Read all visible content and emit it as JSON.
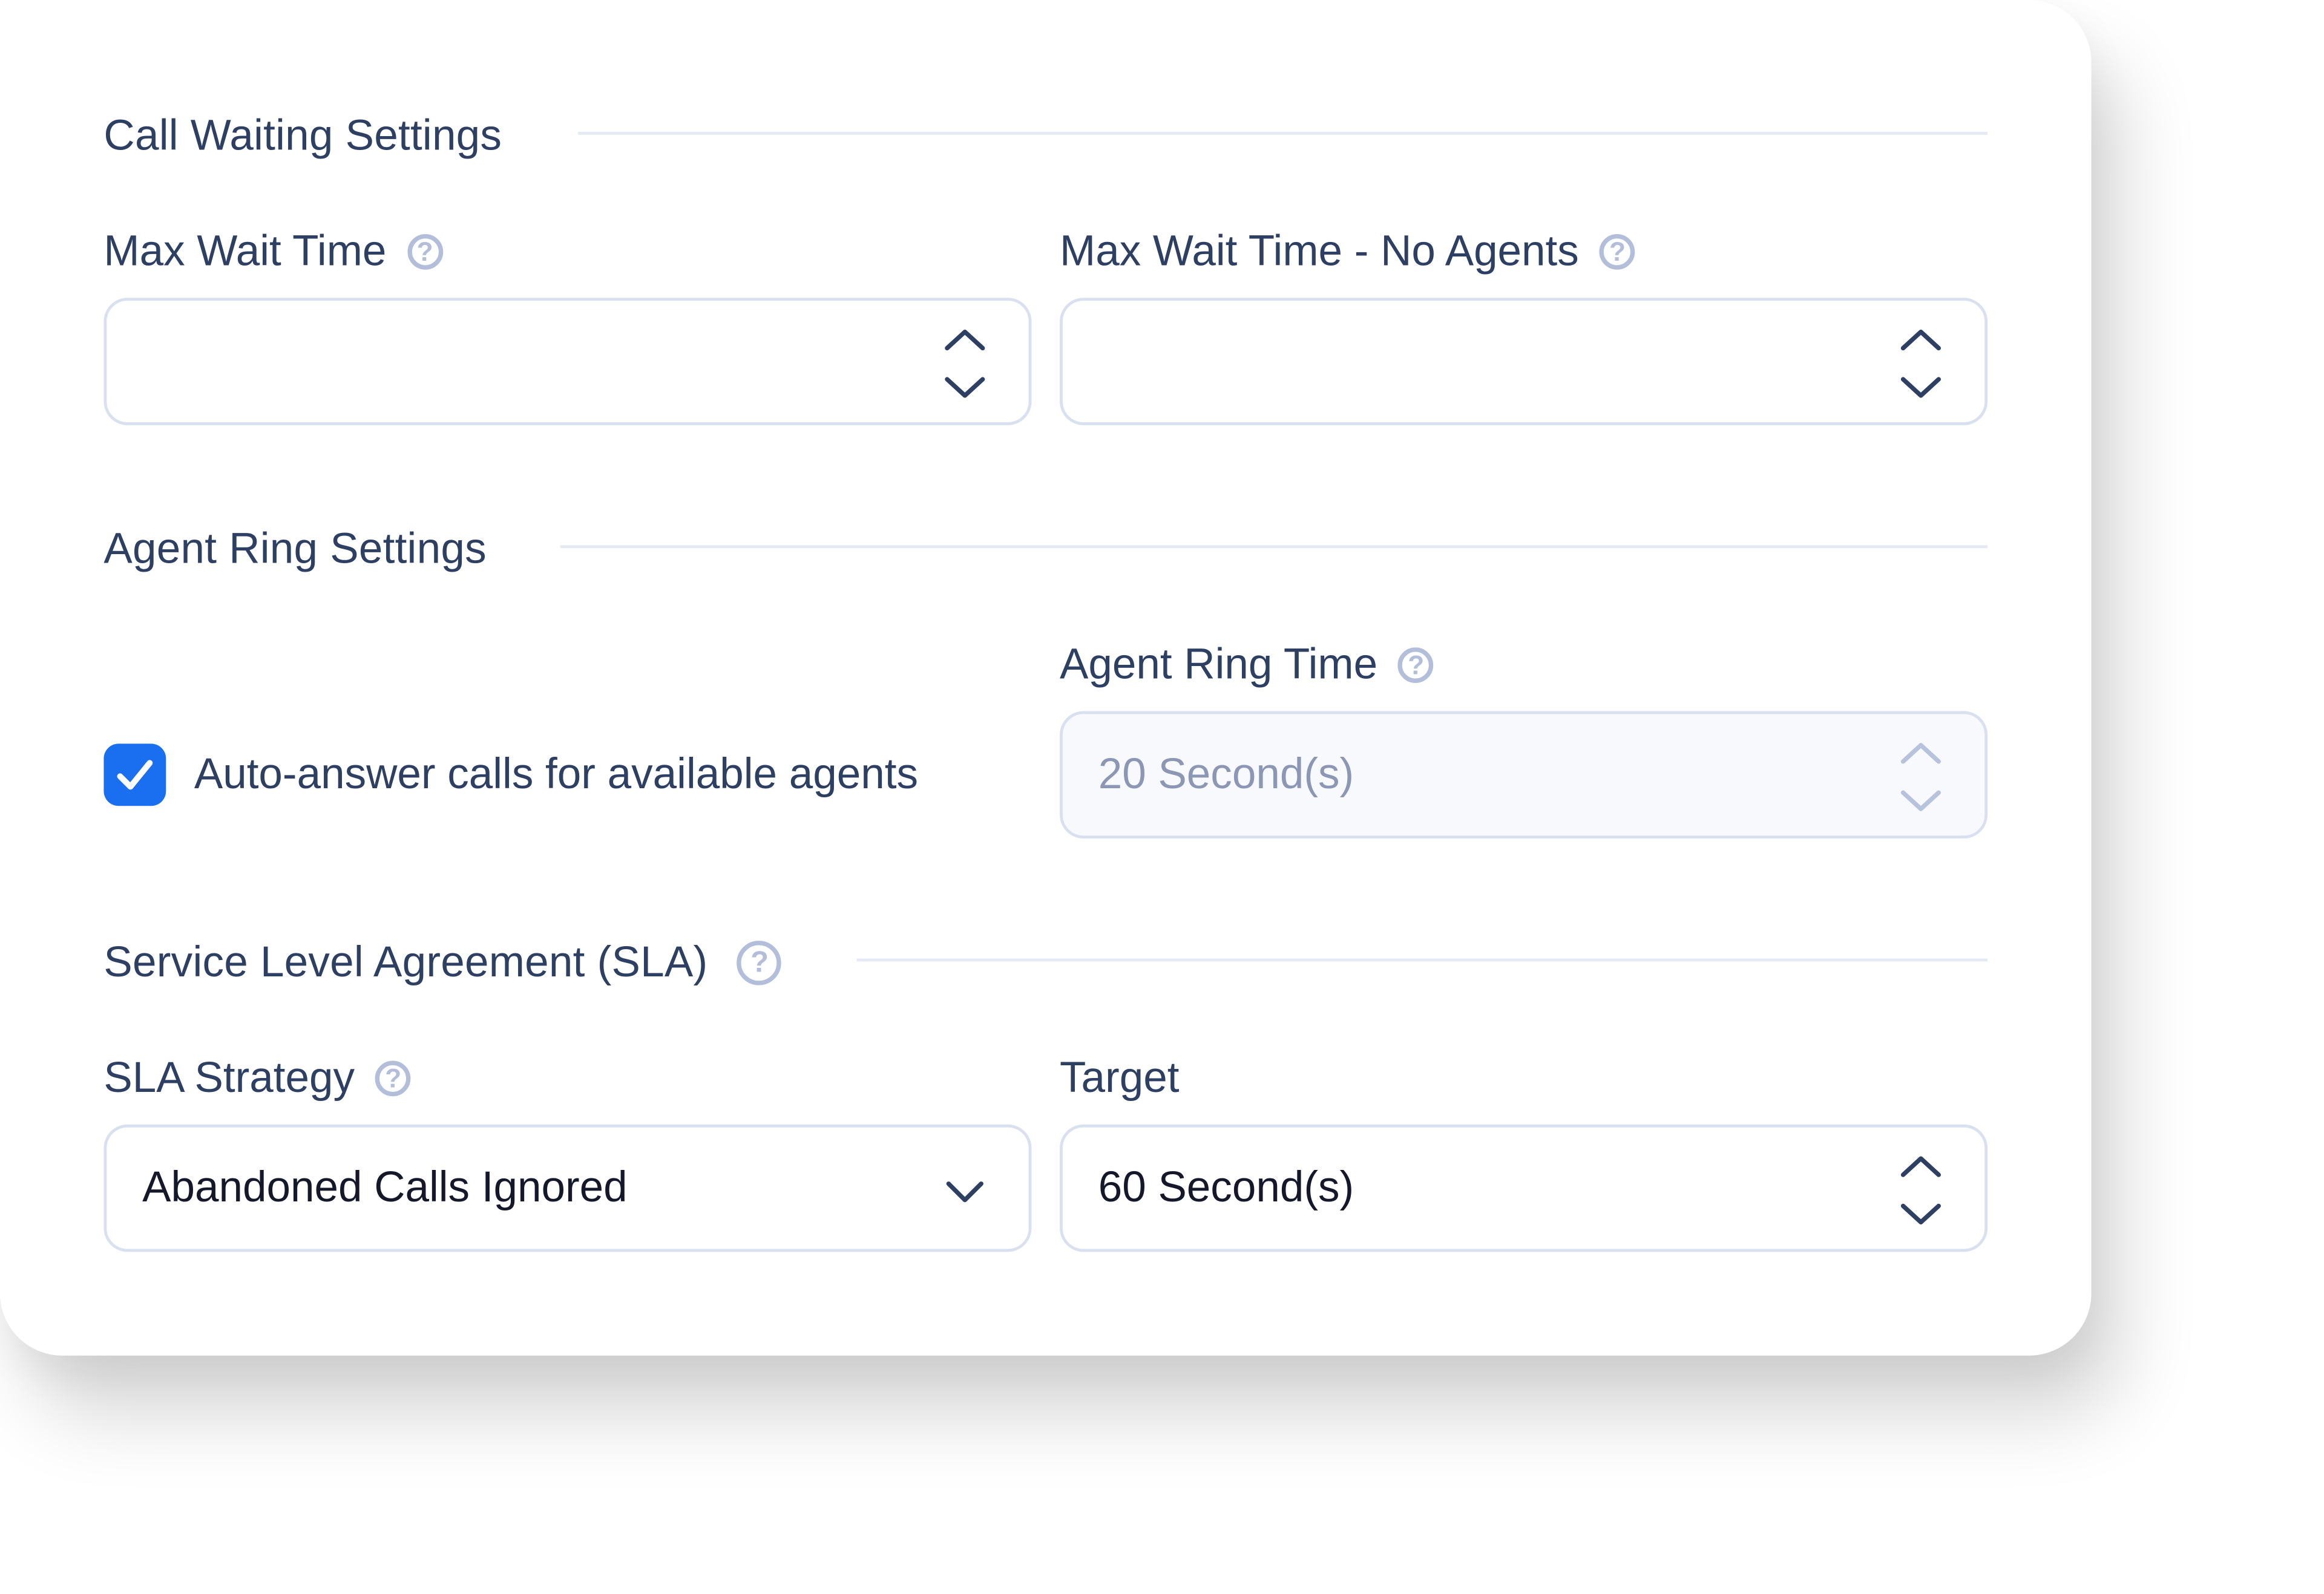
{
  "sections": {
    "call_waiting": {
      "title": "Call Waiting Settings",
      "max_wait_time": {
        "label": "Max Wait Time",
        "value": "",
        "help_icon": "help-circle-icon"
      },
      "max_wait_time_no_agents": {
        "label": "Max Wait Time - No Agents",
        "value": "",
        "help_icon": "help-circle-icon"
      }
    },
    "agent_ring": {
      "title": "Agent Ring Settings",
      "auto_answer": {
        "label": "Auto-answer calls for available agents",
        "checked": true
      },
      "agent_ring_time": {
        "label": "Agent Ring Time",
        "value": "20 Second(s)",
        "disabled": true,
        "help_icon": "help-circle-icon"
      }
    },
    "sla": {
      "title": "Service Level Agreement (SLA)",
      "help_icon": "help-circle-icon",
      "strategy": {
        "label": "SLA Strategy",
        "selected": "Abandoned Calls Ignored",
        "help_icon": "help-circle-icon"
      },
      "target": {
        "label": "Target",
        "value": "60 Second(s)"
      }
    }
  },
  "icons": {
    "help_glyph": "?",
    "stepper": "stepper-arrows-icon",
    "dropdown": "chevron-down-icon",
    "check": "checkmark-icon"
  },
  "colors": {
    "text": "#2d3f63",
    "value_text": "#14182a",
    "disabled_text": "#8b97b4",
    "border": "#d9e1f0",
    "help_icon": "#b3bfda",
    "checkbox_accent": "#1a6ff0"
  }
}
